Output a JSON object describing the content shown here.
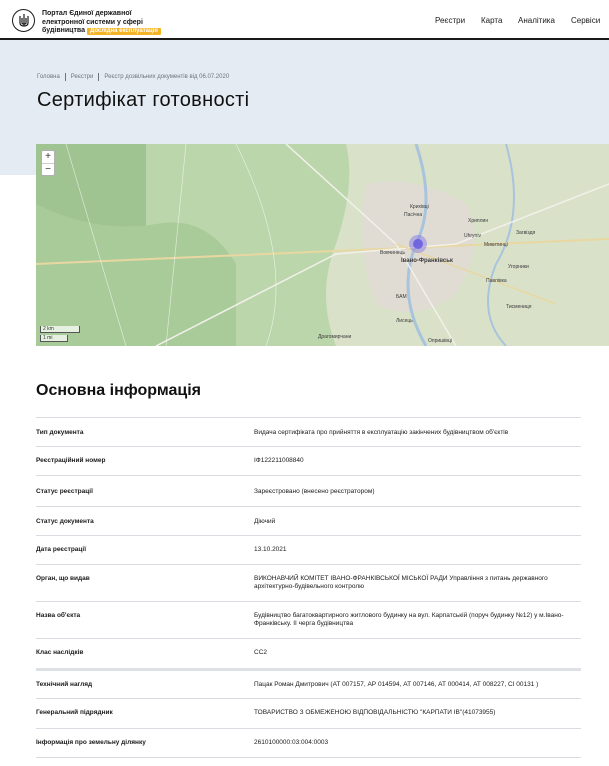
{
  "header": {
    "brand_line1": "Портал Єдиної державної",
    "brand_line2": "електронної системи у сфері",
    "brand_line3": "будівництва",
    "badge": "Дослідна експлуатація",
    "nav": [
      "Реєстри",
      "Карта",
      "Аналітика",
      "Сервіси"
    ]
  },
  "breadcrumbs": [
    "Головна",
    "Реєстри",
    "Реєстр дозвільних документів від 06.07.2020"
  ],
  "page_title": "Сертифікат готовності",
  "map": {
    "zoom_in": "+",
    "zoom_out": "−",
    "scale_km": "2 km",
    "scale_mi": "1 mi",
    "places": [
      "Івано-Франківськ",
      "Пасічна",
      "Крихівці",
      "Хриплин",
      "Угорники",
      "Микитинці",
      "Вовчинець",
      "Uhryniv",
      "Опришівці",
      "Драгомирчани",
      "Загвіздя",
      "Павлівка",
      "БАМ",
      "Тисмениця",
      "Лисець"
    ]
  },
  "section_title": "Основна інформація",
  "rows": [
    {
      "label": "Тип документа",
      "value": "Видача сертифіката про прийняття в експлуатацію закінчених будівництвом об'єктів"
    },
    {
      "label": "Реєстраційний номер",
      "value": "ІФ122211008840"
    },
    {
      "label": "Статус реєстрації",
      "value": "Зареєстровано (внесено реєстратором)"
    },
    {
      "label": "Статус документа",
      "value": "Діючий"
    },
    {
      "label": "Дата реєстрації",
      "value": "13.10.2021"
    },
    {
      "label": "Орган, що видав",
      "value": "ВИКОНАВЧИЙ КОМІТЕТ ІВАНО-ФРАНКІВСЬКОЇ МІСЬКОЇ РАДИ Управління з питань державного архітектурно-будівельного контролю"
    },
    {
      "label": "Назва об'єкта",
      "value": "Будівництво багатоквартирного житлового будинку на вул. Карпатській (поруч будинку №12) у м.Івано-Франківську. ІІ черга будівництва"
    },
    {
      "label": "Клас наслідків",
      "value": "СС2"
    },
    {
      "label": "Технічний нагляд",
      "value": "Пацак Роман Дмитрович (АТ 007157, АР 014594, АТ 007146, АТ 000414, АТ 008227, СІ 00131 )"
    },
    {
      "label": "Генеральний підрядник",
      "value": "ТОВАРИСТВО З ОБМЕЖЕНОЮ ВІДПОВІДАЛЬНІСТЮ \"КАРПАТИ ІВ\"(41073955)"
    },
    {
      "label": "Інформація про земельну ділянку",
      "value": "2610100000:03:004:0003"
    }
  ]
}
